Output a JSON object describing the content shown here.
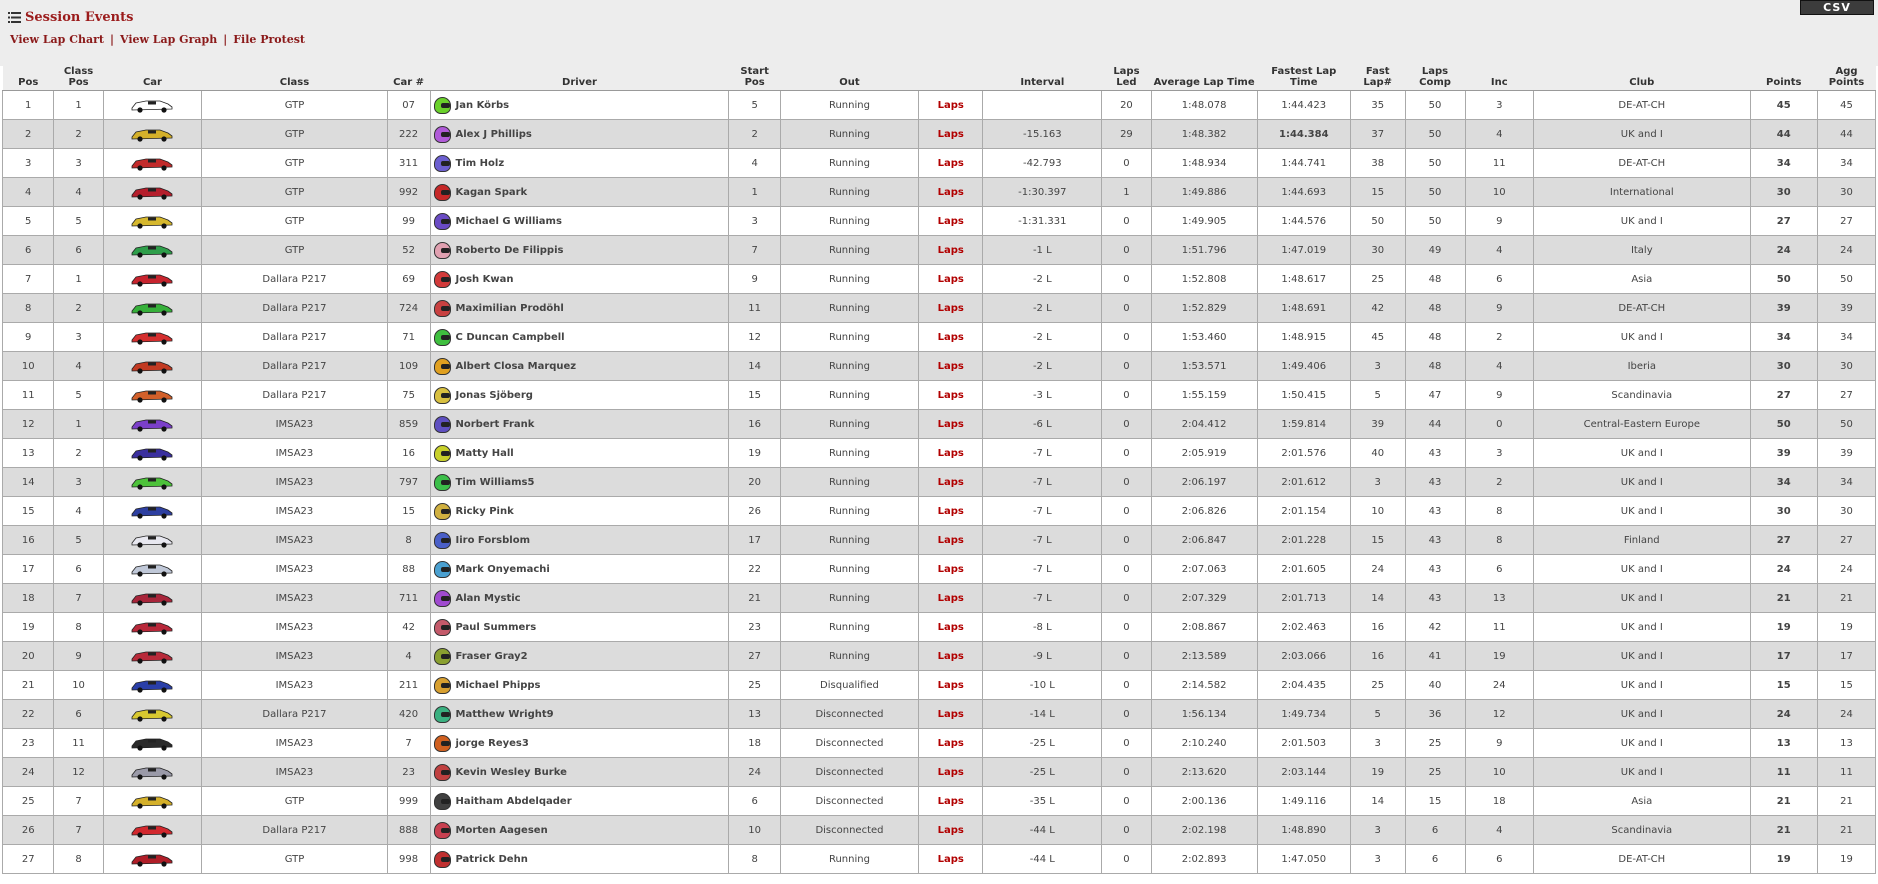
{
  "header": {
    "title": "Session Events",
    "links": [
      "View Lap Chart",
      "View Lap Graph",
      "File Protest"
    ],
    "csv_label": "CSV"
  },
  "columns": [
    "Pos",
    "Class Pos",
    "Car",
    "Class",
    "Car #",
    "Driver",
    "Start Pos",
    "Out",
    "",
    "Interval",
    "Laps Led",
    "Average Lap Time",
    "Fastest Lap Time",
    "Fast Lap#",
    "Laps Comp",
    "Inc",
    "Club",
    "Points",
    "Agg Points"
  ],
  "laps_link_label": "Laps",
  "colors": {
    "accent": "#9b1b1b",
    "laps_link": "#b20000",
    "row_alt": "#dcdcdc",
    "header_bg": "#ededed",
    "csv_bg": "#3c3c3c"
  },
  "rows": [
    {
      "pos": "1",
      "class_pos": "1",
      "class": "GTP",
      "car_num": "07",
      "driver": "Jan Körbs",
      "start": "5",
      "out": "Running",
      "interval": "",
      "laps_led": "20",
      "avg": "1:48.078",
      "fastest": "1:44.423",
      "fast_lap": "35",
      "laps_comp": "50",
      "inc": "3",
      "club": "DE-AT-CH",
      "points": "45",
      "agg": "45",
      "helmet": "#6ad12b",
      "car": "#ffffff"
    },
    {
      "pos": "2",
      "class_pos": "2",
      "class": "GTP",
      "car_num": "222",
      "driver": "Alex J Phillips",
      "start": "2",
      "out": "Running",
      "interval": "-15.163",
      "laps_led": "29",
      "avg": "1:48.382",
      "fastest": "1:44.384",
      "fast_lap": "37",
      "laps_comp": "50",
      "inc": "4",
      "club": "UK and I",
      "points": "44",
      "agg": "44",
      "helmet": "#b05ad8",
      "car": "#d4b02a",
      "fast_best": true
    },
    {
      "pos": "3",
      "class_pos": "3",
      "class": "GTP",
      "car_num": "311",
      "driver": "Tim Holz",
      "start": "4",
      "out": "Running",
      "interval": "-42.793",
      "laps_led": "0",
      "avg": "1:48.934",
      "fastest": "1:44.741",
      "fast_lap": "38",
      "laps_comp": "50",
      "inc": "11",
      "club": "DE-AT-CH",
      "points": "34",
      "agg": "34",
      "helmet": "#6c5fd0",
      "car": "#c22b2b"
    },
    {
      "pos": "4",
      "class_pos": "4",
      "class": "GTP",
      "car_num": "992",
      "driver": "Kagan Spark",
      "start": "1",
      "out": "Running",
      "interval": "-1:30.397",
      "laps_led": "1",
      "avg": "1:49.886",
      "fastest": "1:44.693",
      "fast_lap": "15",
      "laps_comp": "50",
      "inc": "10",
      "club": "International",
      "points": "30",
      "agg": "30",
      "helmet": "#c62828",
      "car": "#b51e2c"
    },
    {
      "pos": "5",
      "class_pos": "5",
      "class": "GTP",
      "car_num": "99",
      "driver": "Michael G Williams",
      "start": "3",
      "out": "Running",
      "interval": "-1:31.331",
      "laps_led": "0",
      "avg": "1:49.905",
      "fastest": "1:44.576",
      "fast_lap": "50",
      "laps_comp": "50",
      "inc": "9",
      "club": "UK and I",
      "points": "27",
      "agg": "27",
      "helmet": "#6a4bc4",
      "car": "#d6b82e"
    },
    {
      "pos": "6",
      "class_pos": "6",
      "class": "GTP",
      "car_num": "52",
      "driver": "Roberto De Filippis",
      "start": "7",
      "out": "Running",
      "interval": "-1 L",
      "laps_led": "0",
      "avg": "1:51.796",
      "fastest": "1:47.019",
      "fast_lap": "30",
      "laps_comp": "49",
      "inc": "4",
      "club": "Italy",
      "points": "24",
      "agg": "24",
      "helmet": "#e0a0b0",
      "car": "#2e9e4a"
    },
    {
      "pos": "7",
      "class_pos": "1",
      "class": "Dallara P217",
      "car_num": "69",
      "driver": "Josh Kwan",
      "start": "9",
      "out": "Running",
      "interval": "-2 L",
      "laps_led": "0",
      "avg": "1:52.808",
      "fastest": "1:48.617",
      "fast_lap": "25",
      "laps_comp": "48",
      "inc": "6",
      "club": "Asia",
      "points": "50",
      "agg": "50",
      "helmet": "#d23a3a",
      "car": "#c7242e"
    },
    {
      "pos": "8",
      "class_pos": "2",
      "class": "Dallara P217",
      "car_num": "724",
      "driver": "Maximilian Prodöhl",
      "start": "11",
      "out": "Running",
      "interval": "-2 L",
      "laps_led": "0",
      "avg": "1:52.829",
      "fastest": "1:48.691",
      "fast_lap": "42",
      "laps_comp": "48",
      "inc": "9",
      "club": "DE-AT-CH",
      "points": "39",
      "agg": "39",
      "helmet": "#c84040",
      "car": "#36b03a"
    },
    {
      "pos": "9",
      "class_pos": "3",
      "class": "Dallara P217",
      "car_num": "71",
      "driver": "C Duncan Campbell",
      "start": "12",
      "out": "Running",
      "interval": "-2 L",
      "laps_led": "0",
      "avg": "1:53.460",
      "fastest": "1:48.915",
      "fast_lap": "45",
      "laps_comp": "48",
      "inc": "2",
      "club": "UK and I",
      "points": "34",
      "agg": "34",
      "helmet": "#3fbf3f",
      "car": "#d42e2e"
    },
    {
      "pos": "10",
      "class_pos": "4",
      "class": "Dallara P217",
      "car_num": "109",
      "driver": "Albert Closa Marquez",
      "start": "14",
      "out": "Running",
      "interval": "-2 L",
      "laps_led": "0",
      "avg": "1:53.571",
      "fastest": "1:49.406",
      "fast_lap": "3",
      "laps_comp": "48",
      "inc": "4",
      "club": "Iberia",
      "points": "30",
      "agg": "30",
      "helmet": "#e0a020",
      "car": "#c23a22"
    },
    {
      "pos": "11",
      "class_pos": "5",
      "class": "Dallara P217",
      "car_num": "75",
      "driver": "Jonas Sjöberg",
      "start": "15",
      "out": "Running",
      "interval": "-3 L",
      "laps_led": "0",
      "avg": "1:55.159",
      "fastest": "1:50.415",
      "fast_lap": "5",
      "laps_comp": "47",
      "inc": "9",
      "club": "Scandinavia",
      "points": "27",
      "agg": "27",
      "helmet": "#d8c040",
      "car": "#d2602a"
    },
    {
      "pos": "12",
      "class_pos": "1",
      "class": "IMSA23",
      "car_num": "859",
      "driver": "Norbert Frank",
      "start": "16",
      "out": "Running",
      "interval": "-6 L",
      "laps_led": "0",
      "avg": "2:04.412",
      "fastest": "1:59.814",
      "fast_lap": "39",
      "laps_comp": "44",
      "inc": "0",
      "club": "Central-Eastern Europe",
      "points": "50",
      "agg": "50",
      "helmet": "#5e4fc0",
      "car": "#7b3fc9"
    },
    {
      "pos": "13",
      "class_pos": "2",
      "class": "IMSA23",
      "car_num": "16",
      "driver": "Matty Hall",
      "start": "19",
      "out": "Running",
      "interval": "-7 L",
      "laps_led": "0",
      "avg": "2:05.919",
      "fastest": "2:01.576",
      "fast_lap": "40",
      "laps_comp": "43",
      "inc": "3",
      "club": "UK and I",
      "points": "39",
      "agg": "39",
      "helmet": "#c8d02a",
      "car": "#3a2f9e"
    },
    {
      "pos": "14",
      "class_pos": "3",
      "class": "IMSA23",
      "car_num": "797",
      "driver": "Tim Williams5",
      "start": "20",
      "out": "Running",
      "interval": "-7 L",
      "laps_led": "0",
      "avg": "2:06.197",
      "fastest": "2:01.612",
      "fast_lap": "3",
      "laps_comp": "43",
      "inc": "2",
      "club": "UK and I",
      "points": "34",
      "agg": "34",
      "helmet": "#3cbf4a",
      "car": "#4dc23a"
    },
    {
      "pos": "15",
      "class_pos": "4",
      "class": "IMSA23",
      "car_num": "15",
      "driver": "Ricky Pink",
      "start": "26",
      "out": "Running",
      "interval": "-7 L",
      "laps_led": "0",
      "avg": "2:06.826",
      "fastest": "2:01.154",
      "fast_lap": "10",
      "laps_comp": "43",
      "inc": "8",
      "club": "UK and I",
      "points": "30",
      "agg": "30",
      "helmet": "#d0b040",
      "car": "#2d3fa0"
    },
    {
      "pos": "16",
      "class_pos": "5",
      "class": "IMSA23",
      "car_num": "8",
      "driver": "Iiro Forsblom",
      "start": "17",
      "out": "Running",
      "interval": "-7 L",
      "laps_led": "0",
      "avg": "2:06.847",
      "fastest": "2:01.228",
      "fast_lap": "15",
      "laps_comp": "43",
      "inc": "8",
      "club": "Finland",
      "points": "27",
      "agg": "27",
      "helmet": "#4a5fc8",
      "car": "#e8e8f0"
    },
    {
      "pos": "17",
      "class_pos": "6",
      "class": "IMSA23",
      "car_num": "88",
      "driver": "Mark Onyemachi",
      "start": "22",
      "out": "Running",
      "interval": "-7 L",
      "laps_led": "0",
      "avg": "2:07.063",
      "fastest": "2:01.605",
      "fast_lap": "24",
      "laps_comp": "43",
      "inc": "6",
      "club": "UK and I",
      "points": "24",
      "agg": "24",
      "helmet": "#4aa0d0",
      "car": "#c0c8d8"
    },
    {
      "pos": "18",
      "class_pos": "7",
      "class": "IMSA23",
      "car_num": "711",
      "driver": "Alan Mystic",
      "start": "21",
      "out": "Running",
      "interval": "-7 L",
      "laps_led": "0",
      "avg": "2:07.329",
      "fastest": "2:01.713",
      "fast_lap": "14",
      "laps_comp": "43",
      "inc": "13",
      "club": "UK and I",
      "points": "21",
      "agg": "21",
      "helmet": "#a04ad0",
      "car": "#a8253a"
    },
    {
      "pos": "19",
      "class_pos": "8",
      "class": "IMSA23",
      "car_num": "42",
      "driver": "Paul Summers",
      "start": "23",
      "out": "Running",
      "interval": "-8 L",
      "laps_led": "0",
      "avg": "2:08.867",
      "fastest": "2:02.463",
      "fast_lap": "16",
      "laps_comp": "42",
      "inc": "11",
      "club": "UK and I",
      "points": "19",
      "agg": "19",
      "helmet": "#c45a6a",
      "car": "#b8283a"
    },
    {
      "pos": "20",
      "class_pos": "9",
      "class": "IMSA23",
      "car_num": "4",
      "driver": "Fraser Gray2",
      "start": "27",
      "out": "Running",
      "interval": "-9 L",
      "laps_led": "0",
      "avg": "2:13.589",
      "fastest": "2:03.066",
      "fast_lap": "16",
      "laps_comp": "41",
      "inc": "19",
      "club": "UK and I",
      "points": "17",
      "agg": "17",
      "helmet": "#8aa030",
      "car": "#b82a3a"
    },
    {
      "pos": "21",
      "class_pos": "10",
      "class": "IMSA23",
      "car_num": "211",
      "driver": "Michael Phipps",
      "start": "25",
      "out": "Disqualified",
      "interval": "-10 L",
      "laps_led": "0",
      "avg": "2:14.582",
      "fastest": "2:04.435",
      "fast_lap": "25",
      "laps_comp": "40",
      "inc": "24",
      "club": "UK and I",
      "points": "15",
      "agg": "15",
      "helmet": "#d8a030",
      "car": "#2a3fa8"
    },
    {
      "pos": "22",
      "class_pos": "6",
      "class": "Dallara P217",
      "car_num": "420",
      "driver": "Matthew Wright9",
      "start": "13",
      "out": "Disconnected",
      "interval": "-14 L",
      "laps_led": "0",
      "avg": "1:56.134",
      "fastest": "1:49.734",
      "fast_lap": "5",
      "laps_comp": "36",
      "inc": "12",
      "club": "UK and I",
      "points": "24",
      "agg": "24",
      "helmet": "#3ab080",
      "car": "#d8c830"
    },
    {
      "pos": "23",
      "class_pos": "11",
      "class": "IMSA23",
      "car_num": "7",
      "driver": "jorge Reyes3",
      "start": "18",
      "out": "Disconnected",
      "interval": "-25 L",
      "laps_led": "0",
      "avg": "2:10.240",
      "fastest": "2:01.503",
      "fast_lap": "3",
      "laps_comp": "25",
      "inc": "9",
      "club": "UK and I",
      "points": "13",
      "agg": "13",
      "helmet": "#d06020",
      "car": "#2a2a2a"
    },
    {
      "pos": "24",
      "class_pos": "12",
      "class": "IMSA23",
      "car_num": "23",
      "driver": "Kevin Wesley Burke",
      "start": "24",
      "out": "Disconnected",
      "interval": "-25 L",
      "laps_led": "0",
      "avg": "2:13.620",
      "fastest": "2:03.144",
      "fast_lap": "19",
      "laps_comp": "25",
      "inc": "10",
      "club": "UK and I",
      "points": "11",
      "agg": "11",
      "helmet": "#c04040",
      "car": "#9a9aa8"
    },
    {
      "pos": "25",
      "class_pos": "7",
      "class": "GTP",
      "car_num": "999",
      "driver": "Haitham Abdelqader",
      "start": "6",
      "out": "Disconnected",
      "interval": "-35 L",
      "laps_led": "0",
      "avg": "2:00.136",
      "fastest": "1:49.116",
      "fast_lap": "14",
      "laps_comp": "15",
      "inc": "18",
      "club": "Asia",
      "points": "21",
      "agg": "21",
      "helmet": "#404040",
      "car": "#d4b02a"
    },
    {
      "pos": "26",
      "class_pos": "7",
      "class": "Dallara P217",
      "car_num": "888",
      "driver": "Morten Aagesen",
      "start": "10",
      "out": "Disconnected",
      "interval": "-44 L",
      "laps_led": "0",
      "avg": "2:02.198",
      "fastest": "1:48.890",
      "fast_lap": "3",
      "laps_comp": "6",
      "inc": "4",
      "club": "Scandinavia",
      "points": "21",
      "agg": "21",
      "helmet": "#c84050",
      "car": "#d2282e"
    },
    {
      "pos": "27",
      "class_pos": "8",
      "class": "GTP",
      "car_num": "998",
      "driver": "Patrick Dehn",
      "start": "8",
      "out": "Running",
      "interval": "-44 L",
      "laps_led": "0",
      "avg": "2:02.893",
      "fastest": "1:47.050",
      "fast_lap": "3",
      "laps_comp": "6",
      "inc": "6",
      "club": "DE-AT-CH",
      "points": "19",
      "agg": "19",
      "helmet": "#c03030",
      "car": "#b01e28"
    }
  ]
}
